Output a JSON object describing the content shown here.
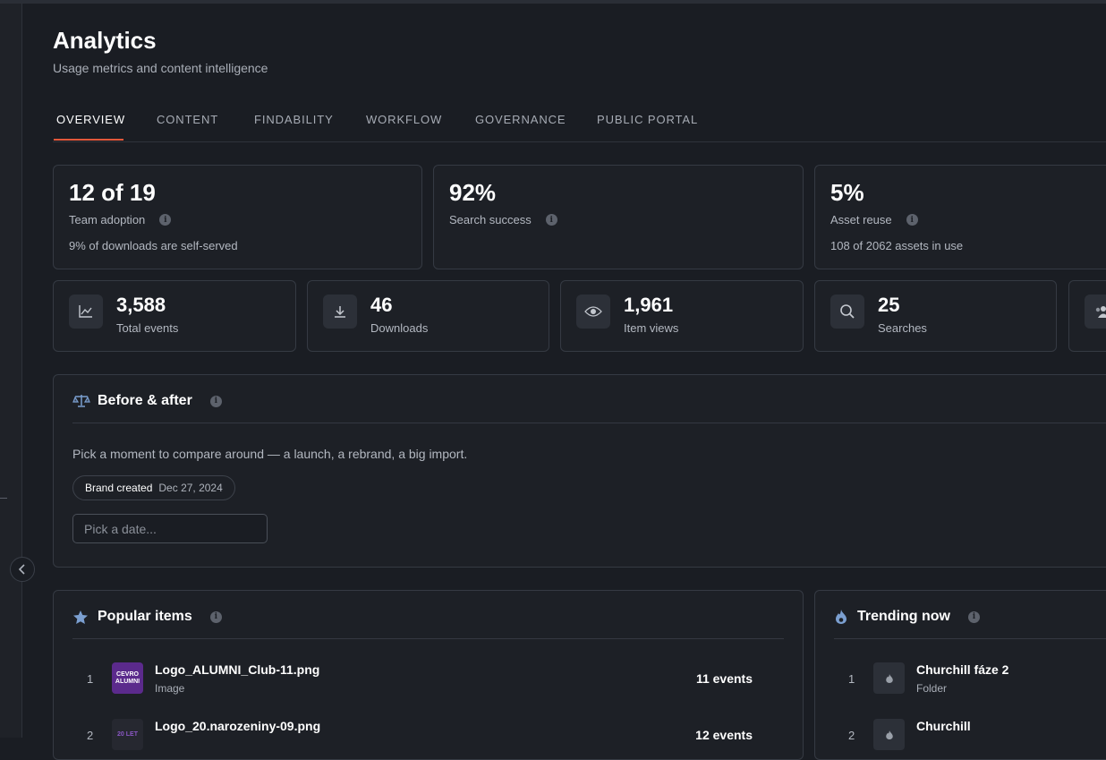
{
  "header": {
    "title": "Analytics",
    "subtitle": "Usage metrics and content intelligence"
  },
  "tabs": [
    "OVERVIEW",
    "CONTENT",
    "FINDABILITY",
    "WORKFLOW",
    "GOVERNANCE",
    "PUBLIC PORTAL"
  ],
  "active_tab": "OVERVIEW",
  "kpis": [
    {
      "value": "12 of 19",
      "label": "Team adoption",
      "sub": "9% of downloads are self-served"
    },
    {
      "value": "92%",
      "label": "Search success",
      "sub": ""
    },
    {
      "value": "5%",
      "label": "Asset reuse",
      "sub": "108 of 2062 assets in use"
    }
  ],
  "stats": [
    {
      "value": "3,588",
      "label": "Total events",
      "icon": "trend-chart-icon"
    },
    {
      "value": "46",
      "label": "Downloads",
      "icon": "download-icon"
    },
    {
      "value": "1,961",
      "label": "Item views",
      "icon": "eye-icon"
    },
    {
      "value": "25",
      "label": "Searches",
      "icon": "search-icon"
    }
  ],
  "before_after": {
    "title": "Before & after",
    "description": "Pick a moment to compare around — a launch, a rebrand, a big import.",
    "chip_label": "Brand created",
    "chip_date": "Dec 27, 2024",
    "date_placeholder": "Pick a date..."
  },
  "popular": {
    "title": "Popular items",
    "items": [
      {
        "rank": "1",
        "name": "Logo_ALUMNI_Club-11.png",
        "type": "Image",
        "events": "11 events",
        "thumb_text": "CEVRO ALUMNI"
      },
      {
        "rank": "2",
        "name": "Logo_20.narozeniny-09.png",
        "type": "",
        "events": "12 events",
        "thumb_text": "20 LET"
      }
    ]
  },
  "trending": {
    "title": "Trending now",
    "items": [
      {
        "rank": "1",
        "name": "Churchill fáze 2",
        "type": "Folder"
      },
      {
        "rank": "2",
        "name": "Churchill",
        "type": ""
      }
    ]
  },
  "colors": {
    "background": "#1a1d23",
    "card": "#1d2026",
    "accent": "#e2573a",
    "icon_blue": "#7b9fd0"
  }
}
